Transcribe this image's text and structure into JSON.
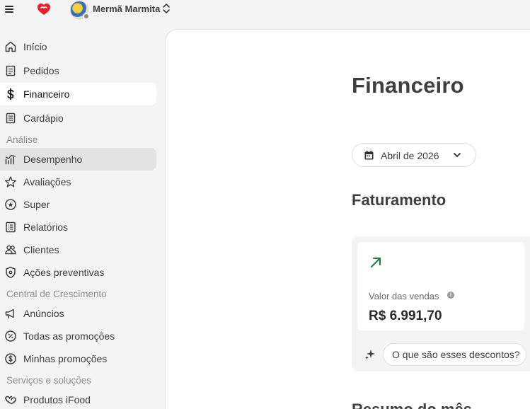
{
  "header": {
    "store_name": "Mermã Marmita"
  },
  "sidebar": {
    "items": [
      {
        "label": "Início",
        "icon": "home-icon"
      },
      {
        "label": "Pedidos",
        "icon": "receipt-icon"
      },
      {
        "label": "Financeiro",
        "icon": "dollar-icon",
        "active": true
      },
      {
        "label": "Cardápio",
        "icon": "menu-book-icon"
      }
    ],
    "section_analise": "Análise",
    "analise_items": [
      {
        "label": "Desempenho",
        "icon": "chart-icon",
        "hover": true
      },
      {
        "label": "Avaliações",
        "icon": "star-icon"
      },
      {
        "label": "Super",
        "icon": "super-badge-icon"
      },
      {
        "label": "Relatórios",
        "icon": "report-icon"
      },
      {
        "label": "Clientes",
        "icon": "users-icon"
      },
      {
        "label": "Ações preventivas",
        "icon": "shield-icon"
      }
    ],
    "section_crescimento": "Central de Crescimento",
    "crescimento_items": [
      {
        "label": "Anúncios",
        "icon": "megaphone-icon"
      },
      {
        "label": "Todas as promoções",
        "icon": "percent-icon"
      },
      {
        "label": "Minhas promoções",
        "icon": "coin-icon"
      }
    ],
    "section_servicos": "Serviços e soluções",
    "servicos_items": [
      {
        "label": "Produtos iFood",
        "icon": "ifood-products-icon"
      }
    ]
  },
  "main": {
    "title": "Financeiro",
    "date_selector": "Abril de 2026",
    "section_title": "Faturamento",
    "card": {
      "label": "Valor das vendas",
      "value": "R$ 6.991,70",
      "trend": "up"
    },
    "discount_button": "O que são esses descontos?",
    "next_heading": "Resumo do mês"
  },
  "colors": {
    "brand_red": "#ea1d2c",
    "trend_green": "#1b7a3e",
    "background": "#f4f4f5"
  }
}
